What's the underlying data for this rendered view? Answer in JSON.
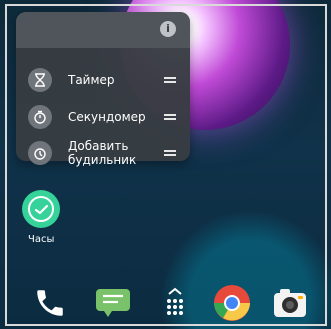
{
  "popup": {
    "items": [
      {
        "label": "Таймер",
        "icon": "hourglass-icon"
      },
      {
        "label": "Секундомер",
        "icon": "stopwatch-icon"
      },
      {
        "label": "Добавить будильник",
        "icon": "alarm-icon"
      }
    ],
    "info_icon": "info-icon"
  },
  "home": {
    "app_label": "Часы"
  },
  "dock": [
    "phone-icon",
    "messages-icon",
    "app-drawer-icon",
    "chrome-icon",
    "camera-icon"
  ]
}
